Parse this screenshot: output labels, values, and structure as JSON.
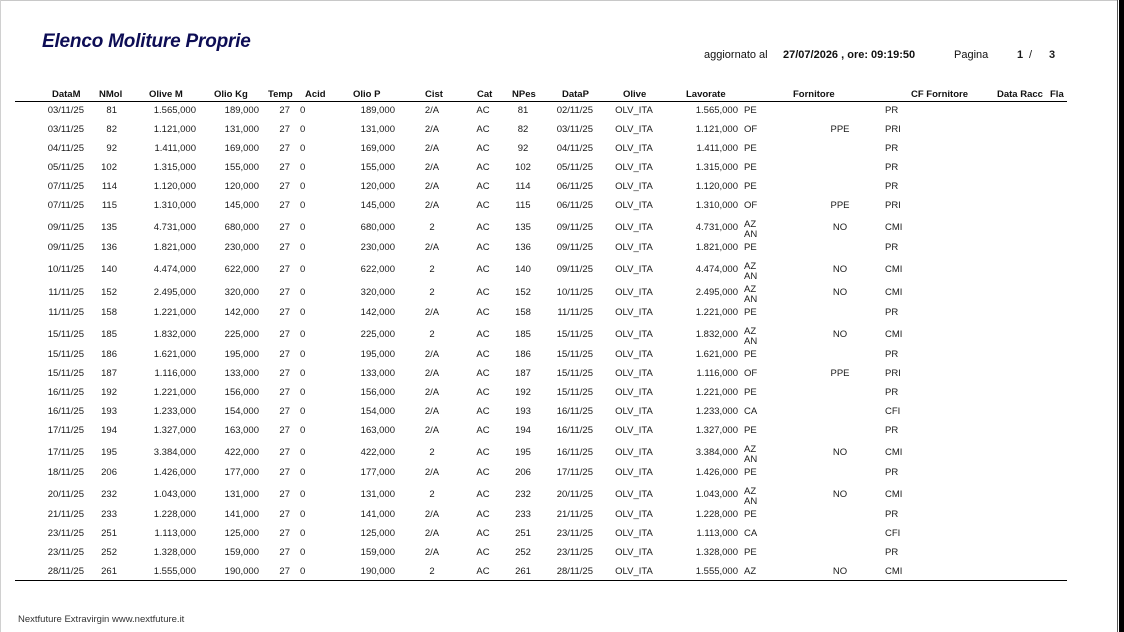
{
  "report": {
    "title": "Elenco Moliture Proprie",
    "updated_label": "aggiornato al",
    "updated_value": "27/07/2026 , ore: 09:19:50",
    "page_label": "Pagina",
    "page_current": "1",
    "page_sep": "/",
    "page_total": "3"
  },
  "columns": [
    "DataM",
    "NMol",
    "Olive M",
    "Olio Kg",
    "Temp",
    "Acid",
    "Olio P",
    "Cist",
    "Cat",
    "NPes",
    "DataP",
    "Olive",
    "Lavorate",
    "Fornitore",
    "CF Fornitore",
    "Data Racc",
    "Fla"
  ],
  "rows": [
    [
      "03/11/25",
      "81",
      "1.565,000",
      "189,000",
      "27",
      "0",
      "189,000",
      "2/A",
      "AC",
      "81",
      "02/11/25",
      "OLV_ITA",
      "1.565,000",
      "PE",
      "",
      "",
      "PR"
    ],
    [
      "03/11/25",
      "82",
      "1.121,000",
      "131,000",
      "27",
      "0",
      "131,000",
      "2/A",
      "AC",
      "82",
      "03/11/25",
      "OLV_ITA",
      "1.121,000",
      "OF",
      "",
      "PPE",
      "PRI"
    ],
    [
      "04/11/25",
      "92",
      "1.411,000",
      "169,000",
      "27",
      "0",
      "169,000",
      "2/A",
      "AC",
      "92",
      "04/11/25",
      "OLV_ITA",
      "1.411,000",
      "PE",
      "",
      "",
      "PR"
    ],
    [
      "05/11/25",
      "102",
      "1.315,000",
      "155,000",
      "27",
      "0",
      "155,000",
      "2/A",
      "AC",
      "102",
      "05/11/25",
      "OLV_ITA",
      "1.315,000",
      "PE",
      "",
      "",
      "PR"
    ],
    [
      "07/11/25",
      "114",
      "1.120,000",
      "120,000",
      "27",
      "0",
      "120,000",
      "2/A",
      "AC",
      "114",
      "06/11/25",
      "OLV_ITA",
      "1.120,000",
      "PE",
      "",
      "",
      "PR"
    ],
    [
      "07/11/25",
      "115",
      "1.310,000",
      "145,000",
      "27",
      "0",
      "145,000",
      "2/A",
      "AC",
      "115",
      "06/11/25",
      "OLV_ITA",
      "1.310,000",
      "OF",
      "",
      "PPE",
      "PRI"
    ],
    [
      "09/11/25",
      "135",
      "4.731,000",
      "680,000",
      "27",
      "0",
      "680,000",
      "2",
      "AC",
      "135",
      "09/11/25",
      "OLV_ITA",
      "4.731,000",
      "AZ",
      "AN",
      "NO",
      "CMI"
    ],
    [
      "09/11/25",
      "136",
      "1.821,000",
      "230,000",
      "27",
      "0",
      "230,000",
      "2/A",
      "AC",
      "136",
      "09/11/25",
      "OLV_ITA",
      "1.821,000",
      "PE",
      "",
      "",
      "PR"
    ],
    [
      "10/11/25",
      "140",
      "4.474,000",
      "622,000",
      "27",
      "0",
      "622,000",
      "2",
      "AC",
      "140",
      "09/11/25",
      "OLV_ITA",
      "4.474,000",
      "AZ",
      "AN",
      "NO",
      "CMI"
    ],
    [
      "11/11/25",
      "152",
      "2.495,000",
      "320,000",
      "27",
      "0",
      "320,000",
      "2",
      "AC",
      "152",
      "10/11/25",
      "OLV_ITA",
      "2.495,000",
      "AZ",
      "AN",
      "NO",
      "CMI"
    ],
    [
      "11/11/25",
      "158",
      "1.221,000",
      "142,000",
      "27",
      "0",
      "142,000",
      "2/A",
      "AC",
      "158",
      "11/11/25",
      "OLV_ITA",
      "1.221,000",
      "PE",
      "",
      "",
      "PR"
    ],
    [
      "15/11/25",
      "185",
      "1.832,000",
      "225,000",
      "27",
      "0",
      "225,000",
      "2",
      "AC",
      "185",
      "15/11/25",
      "OLV_ITA",
      "1.832,000",
      "AZ",
      "AN",
      "NO",
      "CMI"
    ],
    [
      "15/11/25",
      "186",
      "1.621,000",
      "195,000",
      "27",
      "0",
      "195,000",
      "2/A",
      "AC",
      "186",
      "15/11/25",
      "OLV_ITA",
      "1.621,000",
      "PE",
      "",
      "",
      "PR"
    ],
    [
      "15/11/25",
      "187",
      "1.116,000",
      "133,000",
      "27",
      "0",
      "133,000",
      "2/A",
      "AC",
      "187",
      "15/11/25",
      "OLV_ITA",
      "1.116,000",
      "OF",
      "",
      "PPE",
      "PRI"
    ],
    [
      "16/11/25",
      "192",
      "1.221,000",
      "156,000",
      "27",
      "0",
      "156,000",
      "2/A",
      "AC",
      "192",
      "15/11/25",
      "OLV_ITA",
      "1.221,000",
      "PE",
      "",
      "",
      "PR"
    ],
    [
      "16/11/25",
      "193",
      "1.233,000",
      "154,000",
      "27",
      "0",
      "154,000",
      "2/A",
      "AC",
      "193",
      "16/11/25",
      "OLV_ITA",
      "1.233,000",
      "CA",
      "",
      "",
      "CFI"
    ],
    [
      "17/11/25",
      "194",
      "1.327,000",
      "163,000",
      "27",
      "0",
      "163,000",
      "2/A",
      "AC",
      "194",
      "16/11/25",
      "OLV_ITA",
      "1.327,000",
      "PE",
      "",
      "",
      "PR"
    ],
    [
      "17/11/25",
      "195",
      "3.384,000",
      "422,000",
      "27",
      "0",
      "422,000",
      "2",
      "AC",
      "195",
      "16/11/25",
      "OLV_ITA",
      "3.384,000",
      "AZ",
      "AN",
      "NO",
      "CMI"
    ],
    [
      "18/11/25",
      "206",
      "1.426,000",
      "177,000",
      "27",
      "0",
      "177,000",
      "2/A",
      "AC",
      "206",
      "17/11/25",
      "OLV_ITA",
      "1.426,000",
      "PE",
      "",
      "",
      "PR"
    ],
    [
      "20/11/25",
      "232",
      "1.043,000",
      "131,000",
      "27",
      "0",
      "131,000",
      "2",
      "AC",
      "232",
      "20/11/25",
      "OLV_ITA",
      "1.043,000",
      "AZ",
      "AN",
      "NO",
      "CMI"
    ],
    [
      "21/11/25",
      "233",
      "1.228,000",
      "141,000",
      "27",
      "0",
      "141,000",
      "2/A",
      "AC",
      "233",
      "21/11/25",
      "OLV_ITA",
      "1.228,000",
      "PE",
      "",
      "",
      "PR"
    ],
    [
      "23/11/25",
      "251",
      "1.113,000",
      "125,000",
      "27",
      "0",
      "125,000",
      "2/A",
      "AC",
      "251",
      "23/11/25",
      "OLV_ITA",
      "1.113,000",
      "CA",
      "",
      "",
      "CFI"
    ],
    [
      "23/11/25",
      "252",
      "1.328,000",
      "159,000",
      "27",
      "0",
      "159,000",
      "2/A",
      "AC",
      "252",
      "23/11/25",
      "OLV_ITA",
      "1.328,000",
      "PE",
      "",
      "",
      "PR"
    ],
    [
      "28/11/25",
      "261",
      "1.555,000",
      "190,000",
      "27",
      "0",
      "190,000",
      "2",
      "AC",
      "261",
      "28/11/25",
      "OLV_ITA",
      "1.555,000",
      "AZ",
      "",
      "NO",
      "CMI"
    ]
  ],
  "footer": {
    "text": "Nextfuture Extravirgin    www.nextfuture.it"
  }
}
